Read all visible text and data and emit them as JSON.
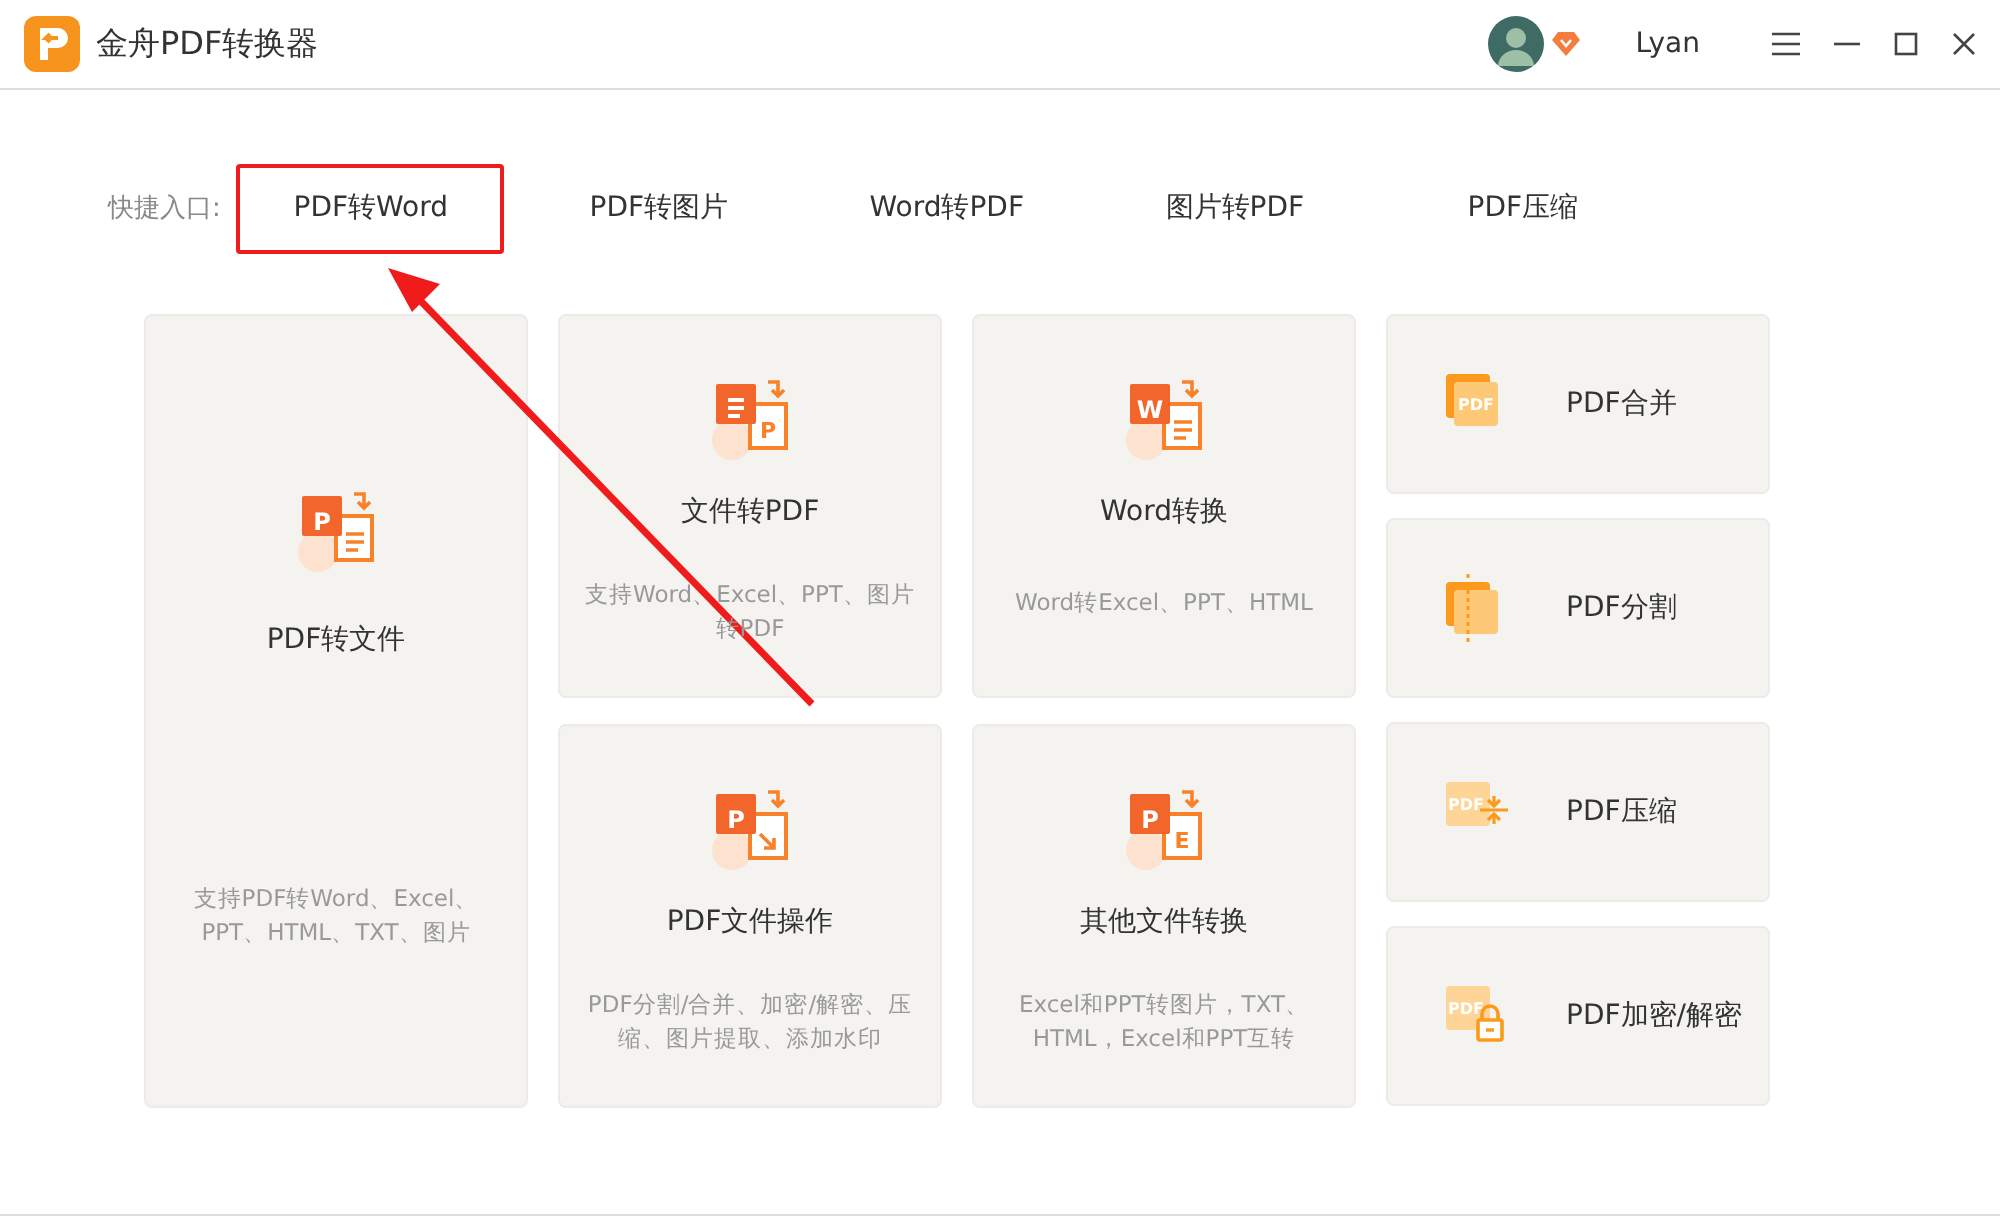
{
  "window": {
    "title": "金舟PDF转换器",
    "user": "Lyan"
  },
  "quick_entry": {
    "label": "快捷入口:",
    "links": [
      {
        "label": "PDF转Word",
        "highlighted": true
      },
      {
        "label": "PDF转图片",
        "highlighted": false
      },
      {
        "label": "Word转PDF",
        "highlighted": false
      },
      {
        "label": "图片转PDF",
        "highlighted": false
      },
      {
        "label": "PDF压缩",
        "highlighted": false
      }
    ]
  },
  "big_cards": [
    {
      "title": "PDF转文件",
      "desc": "支持PDF转Word、Excel、PPT、HTML、TXT、图片",
      "kind": "lines",
      "icon_front": "P"
    },
    {
      "title": "文件转PDF",
      "desc": "支持Word、Excel、PPT、图片转PDF",
      "kind": "letter",
      "icon_back": "P"
    },
    {
      "title": "PDF文件操作",
      "desc": "PDF分割/合并、加密/解密、压缩、图片提取、添加水印",
      "kind": "export",
      "icon_front": "P"
    },
    {
      "title": "Word转换",
      "desc": "Word转Excel、PPT、HTML",
      "kind": "lines",
      "icon_front": "W"
    },
    {
      "title": "其他文件转换",
      "desc": "Excel和PPT转图片，TXT、HTML，Excel和PPT互转",
      "kind": "letter",
      "icon_front": "P",
      "icon_back": "E"
    }
  ],
  "small_cards": [
    {
      "title": "PDF合并",
      "kind": "merge",
      "badge": "PDF"
    },
    {
      "title": "PDF分割",
      "kind": "split"
    },
    {
      "title": "PDF压缩",
      "kind": "compress",
      "badge": "PDF"
    },
    {
      "title": "PDF加密/解密",
      "kind": "lock",
      "badge": "PDF"
    }
  ]
}
